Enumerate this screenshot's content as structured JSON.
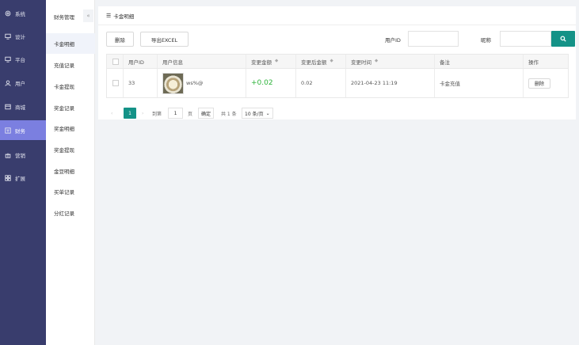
{
  "sidebar": {
    "items": [
      {
        "label": "系统",
        "icon": "gear-icon"
      },
      {
        "label": "设计",
        "icon": "monitor-icon"
      },
      {
        "label": "平台",
        "icon": "monitor-icon"
      },
      {
        "label": "用户",
        "icon": "user-icon"
      },
      {
        "label": "商城",
        "icon": "store-icon"
      },
      {
        "label": "财务",
        "icon": "finance-icon"
      },
      {
        "label": "营销",
        "icon": "gift-icon"
      },
      {
        "label": "扩展",
        "icon": "grid-icon"
      }
    ],
    "active_index": 5,
    "accent": "#7b7fe0",
    "background": "#393d6d"
  },
  "subnav": {
    "title": "财务管理",
    "collapse_icon": "«",
    "items": [
      {
        "label": "卡金明细"
      },
      {
        "label": "充值记录"
      },
      {
        "label": "卡金提现"
      },
      {
        "label": "奖金记录"
      },
      {
        "label": "奖金明细"
      },
      {
        "label": "奖金提现"
      },
      {
        "label": "金豆明细"
      },
      {
        "label": "买单记录"
      },
      {
        "label": "分红记录"
      }
    ],
    "active_index": 0
  },
  "panel": {
    "title": "卡金明细",
    "title_icon": "☰"
  },
  "toolbar": {
    "delete_label": "删除",
    "export_label": "导出EXCEL"
  },
  "filters": {
    "user_id_label": "用户ID",
    "user_id_value": "",
    "nickname_label": "昵称",
    "nickname_value": "",
    "search_icon": "search-icon",
    "search_color": "#149287"
  },
  "table": {
    "columns": [
      "用户ID",
      "用户信息",
      "变更金额",
      "变更后金额",
      "变更时间",
      "备注",
      "操作"
    ],
    "rows": [
      {
        "user_id": "33",
        "user_name": "ws%@",
        "change_amount": "+0.02",
        "after_amount": "0.02",
        "change_time": "2021-04-23 11:19",
        "remark": "卡金充值",
        "action_label": "删除"
      }
    ]
  },
  "pagination": {
    "prev": "‹",
    "current_page": "1",
    "next": "›",
    "goto_label": "到第",
    "goto_value": "1",
    "page_unit": "页",
    "confirm_label": "确定",
    "total_label": "共 1 条",
    "page_size": "10 条/页"
  }
}
